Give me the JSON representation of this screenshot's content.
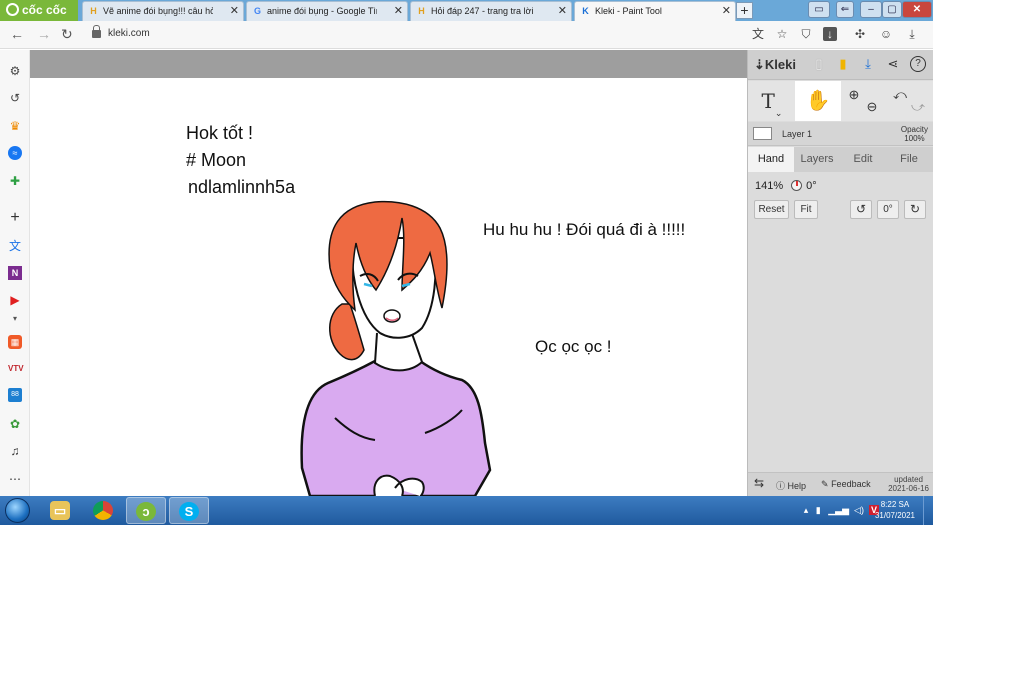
{
  "browser": {
    "brand": "cốc cốc",
    "tabs": [
      {
        "label": "Vẽ anime đói bụng!!! câu hỏi",
        "favicon": "H"
      },
      {
        "label": "anime đói bụng - Google Tìm",
        "favicon": "G"
      },
      {
        "label": "Hỏi đáp 247 - trang tra lời",
        "favicon": "H"
      },
      {
        "label": "Kleki - Paint Tool",
        "favicon": "K"
      }
    ],
    "url": "kleki.com"
  },
  "canvas": {
    "texts": {
      "line1": "Hok tốt !",
      "line2": "# Moon",
      "line3": "ndlamlinnh5a",
      "speech1": "Hu hu hu ! Đói quá đi à !!!!!",
      "speech2": "Ọc ọc ọc !"
    }
  },
  "kleki": {
    "logo": "Kleki",
    "layer_name": "Layer 1",
    "opacity_label": "Opacity",
    "opacity_value": "100%",
    "tabs": [
      "Hand",
      "Layers",
      "Edit",
      "File"
    ],
    "zoom": "141%",
    "rotation": "0°",
    "buttons": {
      "reset": "Reset",
      "fit": "Fit",
      "angle": "0°"
    },
    "bottom": {
      "help": "Help",
      "feedback": "Feedback",
      "updated_label": "updated",
      "updated_date": "2021-06-16"
    }
  },
  "taskbar": {
    "time": "8:22 SA",
    "date": "31/07/2021"
  },
  "colors": {
    "hair": "#ee6a42",
    "sweater": "#d9aaf0",
    "brand_green": "#7ab83a",
    "accent_blue": "#1a6fd6"
  }
}
